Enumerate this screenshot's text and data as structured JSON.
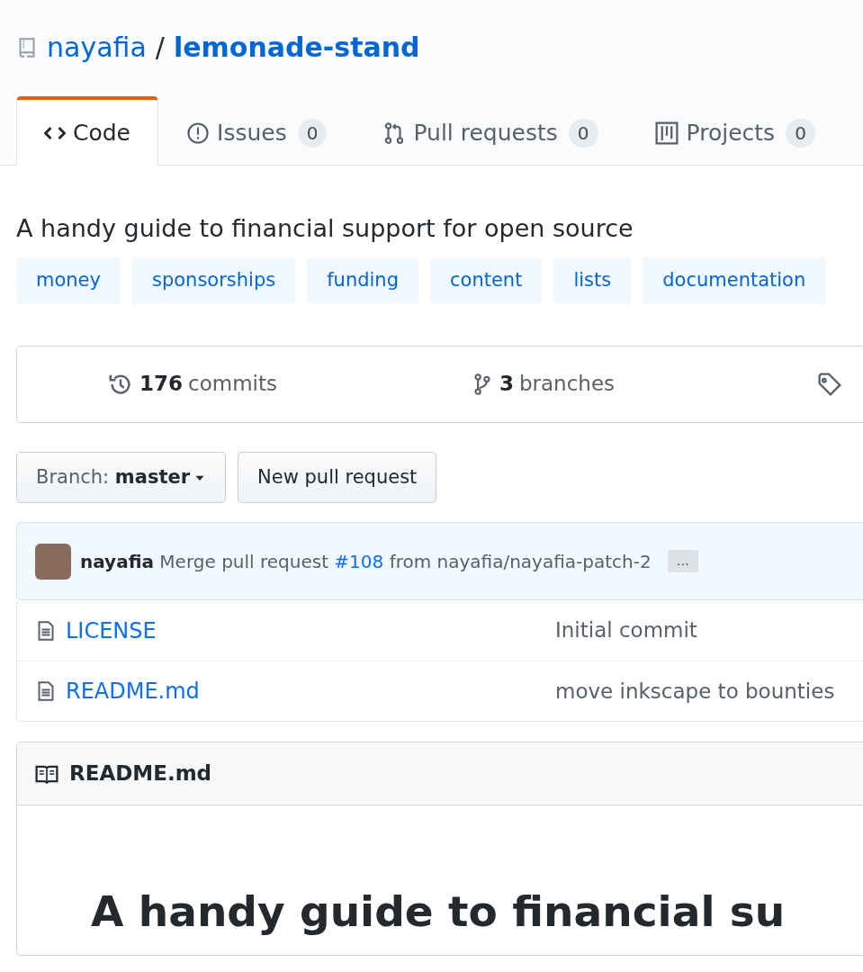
{
  "repo": {
    "owner": "nayafia",
    "separator": "/",
    "name": "lemonade-stand"
  },
  "tabs": [
    {
      "label": "Code",
      "kind": "code",
      "selected": true
    },
    {
      "label": "Issues",
      "count": "0",
      "kind": "issues",
      "selected": false
    },
    {
      "label": "Pull requests",
      "count": "0",
      "kind": "pulls",
      "selected": false
    },
    {
      "label": "Projects",
      "count": "0",
      "kind": "projects",
      "selected": false
    }
  ],
  "description": "A handy guide to financial support for open source",
  "topics": [
    "money",
    "sponsorships",
    "funding",
    "content",
    "lists",
    "documentation"
  ],
  "stats": [
    {
      "kind": "commits",
      "count": "176",
      "label": "commits"
    },
    {
      "kind": "branches",
      "count": "3",
      "label": "branches"
    },
    {
      "kind": "tags"
    }
  ],
  "branch_button": {
    "label": "Branch:",
    "value": "master"
  },
  "new_pr_button": "New pull request",
  "commit": {
    "author": "nayafia",
    "before": "Merge pull request",
    "link": "#108",
    "after": "from nayafia/nayafia-patch-2",
    "ellipsis": "…"
  },
  "files": [
    {
      "name": "LICENSE",
      "message": "Initial commit"
    },
    {
      "name": "README.md",
      "message": "move inkscape to bounties"
    }
  ],
  "readme": {
    "title": "README.md",
    "heading": "A handy guide to financial su"
  }
}
